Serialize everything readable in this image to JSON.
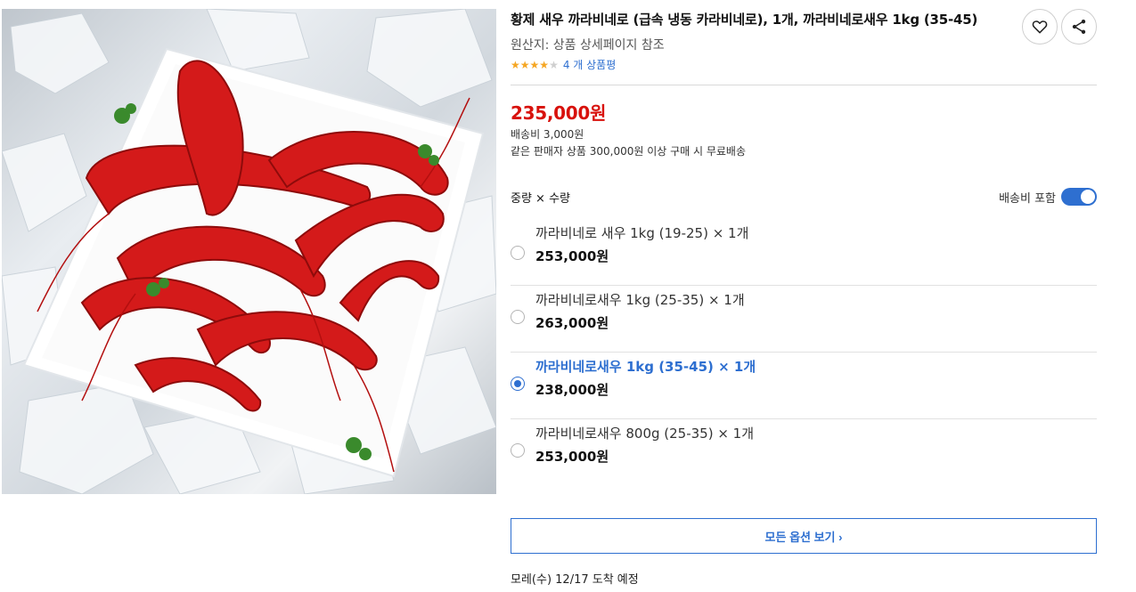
{
  "product": {
    "title": "황제 새우 까라비네로 (급속 냉동 카라비네로), 1개, 까라비네로새우 1kg (35-45)",
    "origin": "원산지: 상품 상세페이지 참조",
    "rating": 4,
    "rating_max": 5,
    "review_text": "4 개 상품평",
    "price": "235,000원",
    "shipping_fee": "배송비 3,000원",
    "free_shipping_note": "같은 판매자 상품 300,000원 이상 구매 시 무료배송"
  },
  "actions": {
    "favorite_icon": "heart-icon",
    "share_icon": "share-icon"
  },
  "option_section": {
    "label": "중량 × 수량",
    "shipping_toggle_label": "배송비 포함",
    "shipping_toggle_on": true
  },
  "options": [
    {
      "name": "까라비네로 새우 1kg (19-25) × 1개",
      "price": "253,000원",
      "selected": false
    },
    {
      "name": "까라비네로새우 1kg (25-35) × 1개",
      "price": "263,000원",
      "selected": false
    },
    {
      "name": "까라비네로새우 1kg (35-45) × 1개",
      "price": "238,000원",
      "selected": true
    },
    {
      "name": "까라비네로새우 800g (25-35) × 1개",
      "price": "253,000원",
      "selected": false
    }
  ],
  "all_options_button": "모든 옵션 보기 ›",
  "delivery_estimate": "모레(수) 12/17 도착 예정",
  "colors": {
    "price_red": "#d8110c",
    "accent_blue": "#2e6fd0",
    "star_yellow": "#f5a623"
  }
}
